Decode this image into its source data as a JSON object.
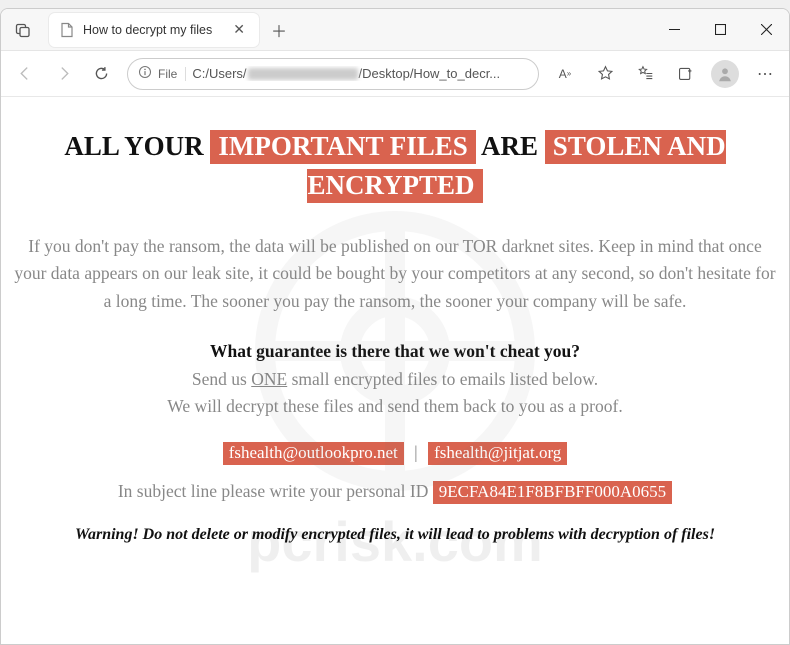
{
  "window": {
    "tab_title": "How to decrypt my files",
    "url_prefix": "C:/Users/",
    "url_suffix": "/Desktop/How_to_decr...",
    "file_label": "File"
  },
  "page": {
    "headline_pre": "ALL YOUR ",
    "headline_red1": "IMPORTANT FILES",
    "headline_mid": " ARE ",
    "headline_red2": "STOLEN AND ENCRYPTED",
    "para1": "If you don't pay the ransom, the data will be published on our TOR darknet sites. Keep in mind that once your data appears on our leak site, it could be bought by your competitors at any second, so don't hesitate for a long time. The sooner you pay the ransom, the sooner your company will be safe.",
    "guarantee_q": "What guarantee is there that we won't cheat you?",
    "send_pre": "Send us ",
    "send_one": "ONE",
    "send_post": " small encrypted files to emails listed below.",
    "decrypt_line": "We will decrypt these files and send them back to you as a proof.",
    "email1": "fshealth@outlookpro.net",
    "email_sep": "|",
    "email2": "fshealth@jitjat.org",
    "id_pre": "In subject line please write your personal ID ",
    "personal_id": "9ECFA84E1F8BFBFF000A0655",
    "warning": "Warning! Do not delete or modify encrypted files, it will lead to problems with decryption of files!"
  },
  "watermark": "pcrisk.com"
}
